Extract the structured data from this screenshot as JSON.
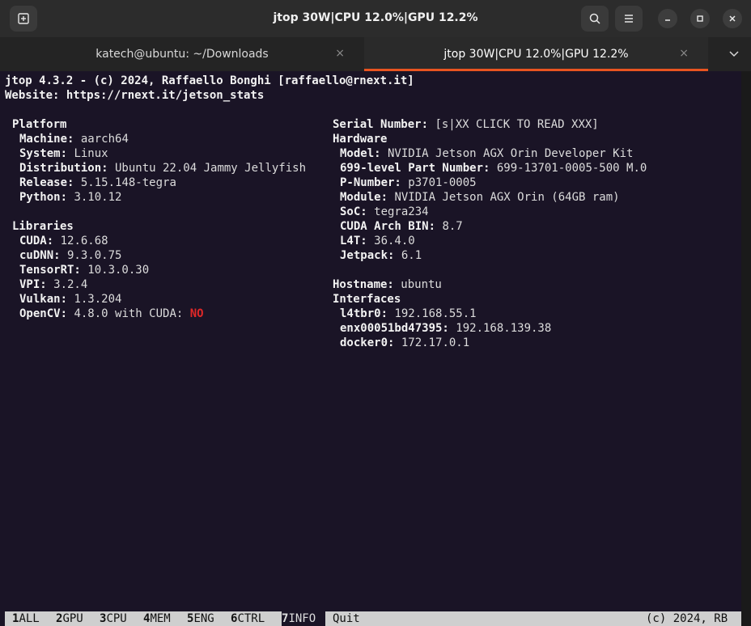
{
  "window": {
    "title": "jtop 30W|CPU 12.0%|GPU 12.2%"
  },
  "tabs": [
    {
      "label": "katech@ubuntu: ~/Downloads"
    },
    {
      "label": "jtop 30W|CPU 12.0%|GPU 12.2%"
    }
  ],
  "icons": {
    "close_tab": "×",
    "chevron": "⌄"
  },
  "header": {
    "line1": "jtop 4.3.2 - (c) 2024, Raffaello Bonghi [raffaello@rnext.it]",
    "line2": "Website: https://rnext.it/jetson_stats"
  },
  "platform": {
    "title": "Platform",
    "rows": [
      {
        "k": "Machine:",
        "v": " aarch64"
      },
      {
        "k": "System:",
        "v": " Linux"
      },
      {
        "k": "Distribution:",
        "v": " Ubuntu 22.04 Jammy Jellyfish"
      },
      {
        "k": "Release:",
        "v": " 5.15.148-tegra"
      },
      {
        "k": "Python:",
        "v": " 3.10.12"
      }
    ]
  },
  "libraries": {
    "title": "Libraries",
    "rows": [
      {
        "k": "CUDA:",
        "v": " 12.6.68"
      },
      {
        "k": "cuDNN:",
        "v": " 9.3.0.75"
      },
      {
        "k": "TensorRT:",
        "v": " 10.3.0.30"
      },
      {
        "k": "VPI:",
        "v": " 3.2.4"
      },
      {
        "k": "Vulkan:",
        "v": " 1.3.204"
      },
      {
        "k": "OpenCV:",
        "v": " 4.8.0 with CUDA: ",
        "flag": "NO"
      }
    ]
  },
  "serial": {
    "k": "Serial Number:",
    "v": " [s|XX CLICK TO READ XXX]"
  },
  "hardware": {
    "title": "Hardware",
    "rows": [
      {
        "k": "Model:",
        "v": " NVIDIA Jetson AGX Orin Developer Kit"
      },
      {
        "k": "699-level Part Number:",
        "v": " 699-13701-0005-500 M.0"
      },
      {
        "k": "P-Number:",
        "v": " p3701-0005"
      },
      {
        "k": "Module:",
        "v": " NVIDIA Jetson AGX Orin (64GB ram)"
      },
      {
        "k": "SoC:",
        "v": " tegra234"
      },
      {
        "k": "CUDA Arch BIN:",
        "v": " 8.7"
      },
      {
        "k": "L4T:",
        "v": " 36.4.0"
      },
      {
        "k": "Jetpack:",
        "v": " 6.1"
      }
    ]
  },
  "hostname": {
    "k": "Hostname:",
    "v": " ubuntu"
  },
  "interfaces": {
    "title": "Interfaces",
    "rows": [
      {
        "k": "l4tbr0:",
        "v": " 192.168.55.1"
      },
      {
        "k": "enx00051bd47395:",
        "v": " 192.168.139.38"
      },
      {
        "k": "docker0:",
        "v": " 172.17.0.1"
      }
    ]
  },
  "menu": [
    {
      "n": "1",
      "l": "ALL"
    },
    {
      "n": "2",
      "l": "GPU"
    },
    {
      "n": "3",
      "l": "CPU"
    },
    {
      "n": "4",
      "l": "MEM"
    },
    {
      "n": "5",
      "l": "ENG"
    },
    {
      "n": "6",
      "l": "CTRL"
    },
    {
      "n": "7",
      "l": "INFO"
    }
  ],
  "quit": "Quit",
  "copyright": "(c) 2024, RB",
  "colors": {
    "accent": "#e95420",
    "term_bg": "#1a1426",
    "error": "#e02828"
  }
}
